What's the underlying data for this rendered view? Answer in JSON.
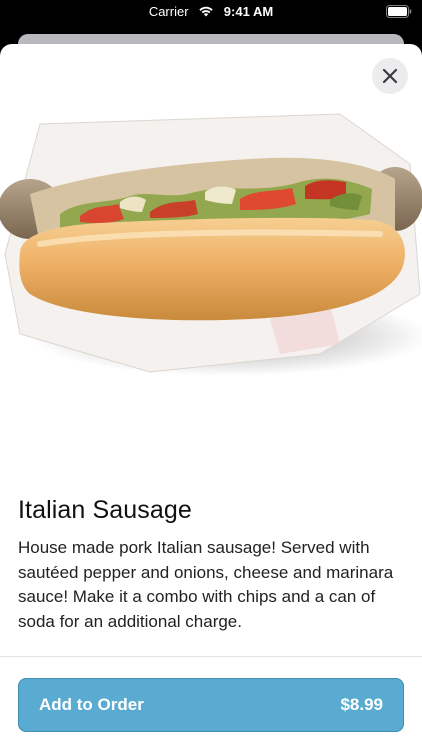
{
  "status_bar": {
    "carrier": "Carrier",
    "time": "9:41 AM",
    "wifi_icon": "wifi-icon",
    "battery_icon": "battery-icon"
  },
  "modal": {
    "close_icon": "close-icon",
    "image_subject": "food-photo-icon",
    "title": "Italian Sausage",
    "description": "House made pork Italian sausage! Served with sautéed pepper and onions, cheese and marinara sauce! Make it a combo with chips and a can of soda for an additional charge."
  },
  "order_button": {
    "label": "Add to Order",
    "price": "$8.99"
  },
  "colors": {
    "accent": "#5aabd1",
    "background": "#ffffff",
    "status_bar_bg": "#000000"
  }
}
